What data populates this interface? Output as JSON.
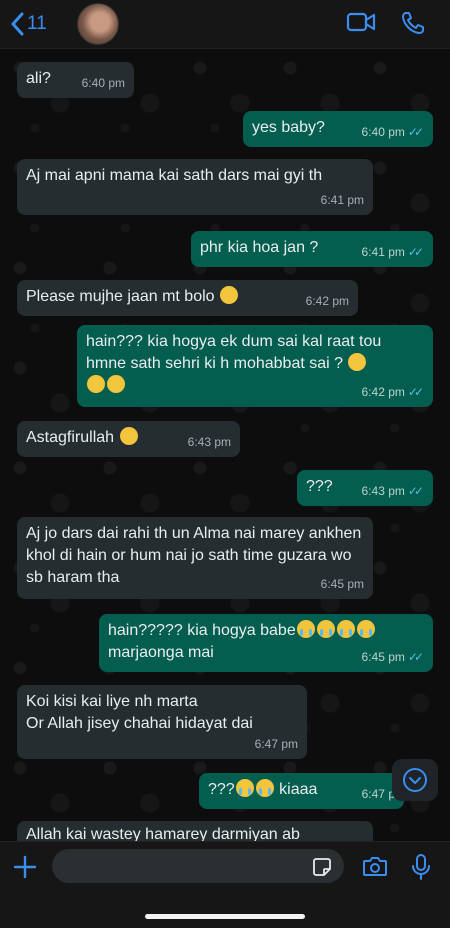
{
  "header": {
    "back_count": "11",
    "accent": "#3a8ef0",
    "icons": [
      "chevron-left-icon",
      "video-call-icon",
      "phone-icon"
    ]
  },
  "colors": {
    "incoming_bubble": "#262d31",
    "outgoing_bubble": "#045e4f",
    "read_ticks": "#53bdeb"
  },
  "messages": [
    {
      "direction": "in",
      "text": "ali?",
      "time": "6:40 pm"
    },
    {
      "direction": "out",
      "text": "yes baby?",
      "time": "6:40 pm",
      "status": "read"
    },
    {
      "direction": "in",
      "text": "Aj mai apni mama kai sath dars mai gyi th",
      "time": "6:41 pm"
    },
    {
      "direction": "out",
      "text": "phr kia hoa jan ?",
      "time": "6:41 pm",
      "status": "read"
    },
    {
      "direction": "in",
      "text": "Please mujhe jaan mt bolo",
      "time": "6:42 pm",
      "emoji": [
        "face-with-rolling-eyes"
      ]
    },
    {
      "direction": "out",
      "text": "hain??? kia hogya ek dum sai kal raat tou hmne sath sehri ki h mohabbat sai ?",
      "time": "6:42 pm",
      "status": "read",
      "emoji": [
        "confused-face",
        "confused-face",
        "slightly-frowning-face"
      ]
    },
    {
      "direction": "in",
      "text": "Astagfirullah",
      "time": "6:43 pm",
      "emoji": [
        "smirking-face"
      ]
    },
    {
      "direction": "out",
      "text": "???",
      "time": "6:43 pm",
      "status": "read"
    },
    {
      "direction": "in",
      "text": "Aj jo dars dai rahi th un Alma nai marey ankhen khol di hain or hum nai jo sath time guzara wo sb haram tha",
      "time": "6:45 pm"
    },
    {
      "direction": "out",
      "text": "hain????? kia hogya babe",
      "text2": "marjaonga mai",
      "time": "6:45 pm",
      "status": "read",
      "emoji": [
        "loudly-crying-face",
        "loudly-crying-face",
        "loudly-crying-face",
        "loudly-crying-face"
      ]
    },
    {
      "direction": "in",
      "text": "Koi kisi kai liye nh marta",
      "text2": "Or Allah jisey chahai hidayat dai",
      "time": "6:47 pm"
    },
    {
      "direction": "out",
      "text": "???",
      "text2": "kiaaa",
      "time": "6:47 p",
      "status": "read",
      "emoji": [
        "loudly-crying-face",
        "loudly-crying-face"
      ]
    },
    {
      "direction": "in",
      "text": "Allah kai wastey hamarey darmiyan ab",
      "time": ""
    }
  ],
  "composer": {
    "icons": [
      "plus-icon",
      "sticker-icon",
      "camera-icon",
      "microphone-icon"
    ]
  },
  "scroll_button_icon": "chevron-down-icon"
}
